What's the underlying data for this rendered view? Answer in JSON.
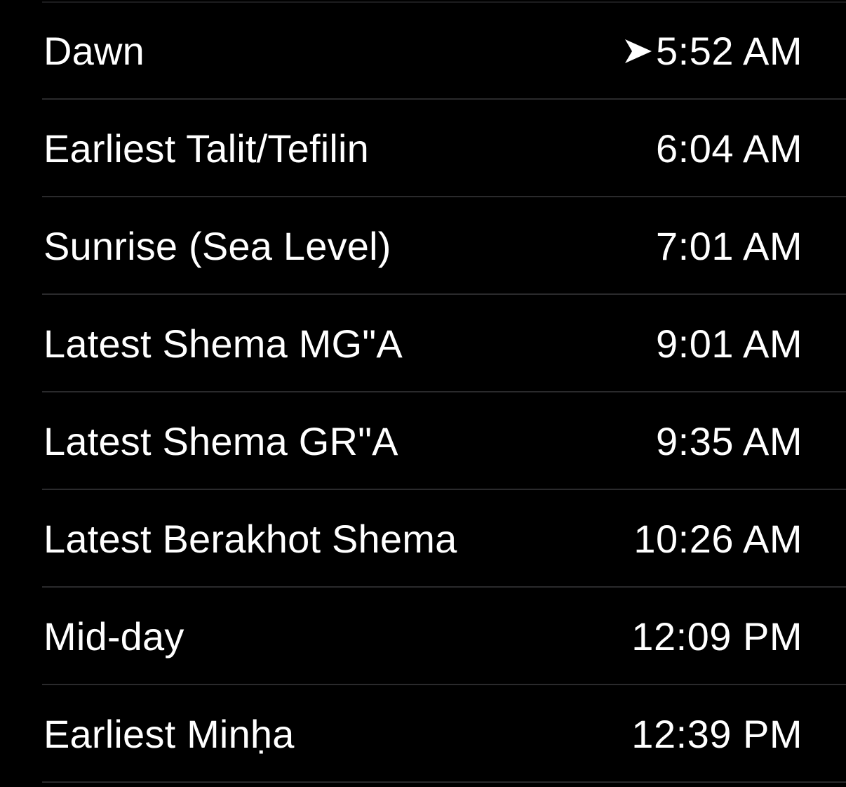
{
  "zmanim": {
    "items": [
      {
        "label": "Dawn",
        "time": "5:52 AM",
        "icon": "location-arrow-icon"
      },
      {
        "label": "Earliest Talit/Tefilin",
        "time": "6:04 AM"
      },
      {
        "label": "Sunrise (Sea Level)",
        "time": "7:01 AM"
      },
      {
        "label": "Latest Shema MG\"A",
        "time": "9:01 AM"
      },
      {
        "label": "Latest Shema GR\"A",
        "time": "9:35 AM"
      },
      {
        "label": "Latest Berakhot Shema",
        "time": "10:26 AM"
      },
      {
        "label": "Mid-day",
        "time": "12:09 PM"
      },
      {
        "label": "Earliest Minḥa",
        "time": "12:39 PM"
      }
    ]
  },
  "colors": {
    "background": "#000000",
    "text": "#ffffff",
    "divider": "#2a2a2c"
  }
}
